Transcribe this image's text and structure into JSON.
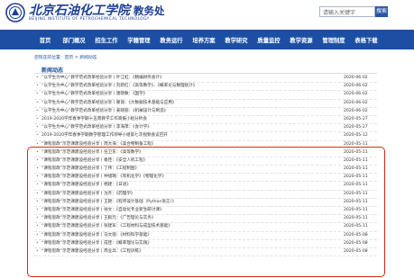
{
  "header": {
    "university_name_cn": "北京石油化工学院",
    "university_name_en": "BEIJING INSTITUTE OF PETROCHEMICAL TECHNOLOGY",
    "department": "教务处",
    "logo_icon": "university-seal-icon"
  },
  "search": {
    "placeholder": "请输入关键字",
    "button_label": "搜索"
  },
  "nav": {
    "items": [
      "首页",
      "部门概况",
      "招生工作",
      "学籍管理",
      "教务运行",
      "培养方案",
      "教学研究",
      "质量监控",
      "教学资源",
      "管理制度",
      "表格下载"
    ]
  },
  "breadcrumb": "您现在的位置：首页 > 新闻动态",
  "section_title": "新闻动态",
  "news": [
    {
      "title": "“以学生为中心”教学范式改革经验分享丨叶江虹：《精编财务会计》",
      "date": "2020-06-02"
    },
    {
      "title": "“以学生为中心”教学范式改革经验分享丨刘新红：《高等数学》、《概率论与数理统计》",
      "date": "2020-06-02"
    },
    {
      "title": "“以学生为中心”教学范式改革经验分享丨唐晓敏：《国学》",
      "date": "2020-06-02"
    },
    {
      "title": "“以学生为中心”教学范式改革经验分享丨翟丽：《大数据技术基础与应用》",
      "date": "2020-06-02"
    },
    {
      "title": "“以学生为中心”教学范式改革经验分享丨姜晓丽：《机械设计与制造》",
      "date": "2020-06-02"
    },
    {
      "title": "2019-2020学年春季学期十五周教学工作简报小组分析会",
      "date": "2020-05-27"
    },
    {
      "title": "“以学生为中心”教学范式改革经验分享丨李海萍：《会计学》",
      "date": "2020-05-27"
    },
    {
      "title": "2019-2020学年春季学期教学管理工作领导小组第七次视频会议召开",
      "date": "2020-05-12"
    },
    {
      "title": "“课程思政”示范课建设经验分享丨周大海：《美合物制备工程》",
      "date": "2020-05-11"
    },
    {
      "title": "“课程思政”示范课建设经验分享丨任卫东：《高等数学》",
      "date": "2020-05-11"
    },
    {
      "title": "“课程思政”示范课建设经验分享丨秦佳：《安全人机工程》",
      "date": "2020-05-11"
    },
    {
      "title": "“课程思政”示范课建设经验分享丨丁伟：《工程制图》",
      "date": "2020-05-11"
    },
    {
      "title": "“课程思政”示范课建设经验分享丨仲旭璐：《有机化学》《物理化学》",
      "date": "2020-05-11"
    },
    {
      "title": "“课程思政”示范课建设经验分享丨杨建：《日语》",
      "date": "2020-05-11"
    },
    {
      "title": "“课程思政”示范课建设经验分享丨沈齐：《药理学》",
      "date": "2020-05-11"
    },
    {
      "title": "“课程思政”示范课建设经验分享丨王艳：《程序设计基础（Python语言）》",
      "date": "2020-05-11"
    },
    {
      "title": "“课程思政”示范课建设经验分享丨徐文：《自动化专业新生研讨课》",
      "date": "2020-05-11"
    },
    {
      "title": "“课程思政”示范课建设经验分享丨王殿元：《广告理论与实务》",
      "date": "2020-05-11"
    },
    {
      "title": "“课程思政”示范课建设经验分享丨张建军：《工程材料与成型技术基础》",
      "date": "2020-05-11"
    },
    {
      "title": "“课程思政”示范课建设经验分享丨马文丽：《材料科学基础》",
      "date": "2020-05-08"
    },
    {
      "title": "“课程思政”示范课建设经验分享丨成佳：《概率理论与实践》",
      "date": "2020-05-08"
    },
    {
      "title": "“课程思政”示范课建设经验分享丨周业兵：《工程训练》",
      "date": "2020-05-08"
    }
  ],
  "colors": {
    "nav_bg": "#1c4fa3",
    "brand_blue": "#1c3f94",
    "highlight_red": "#e0251b"
  }
}
